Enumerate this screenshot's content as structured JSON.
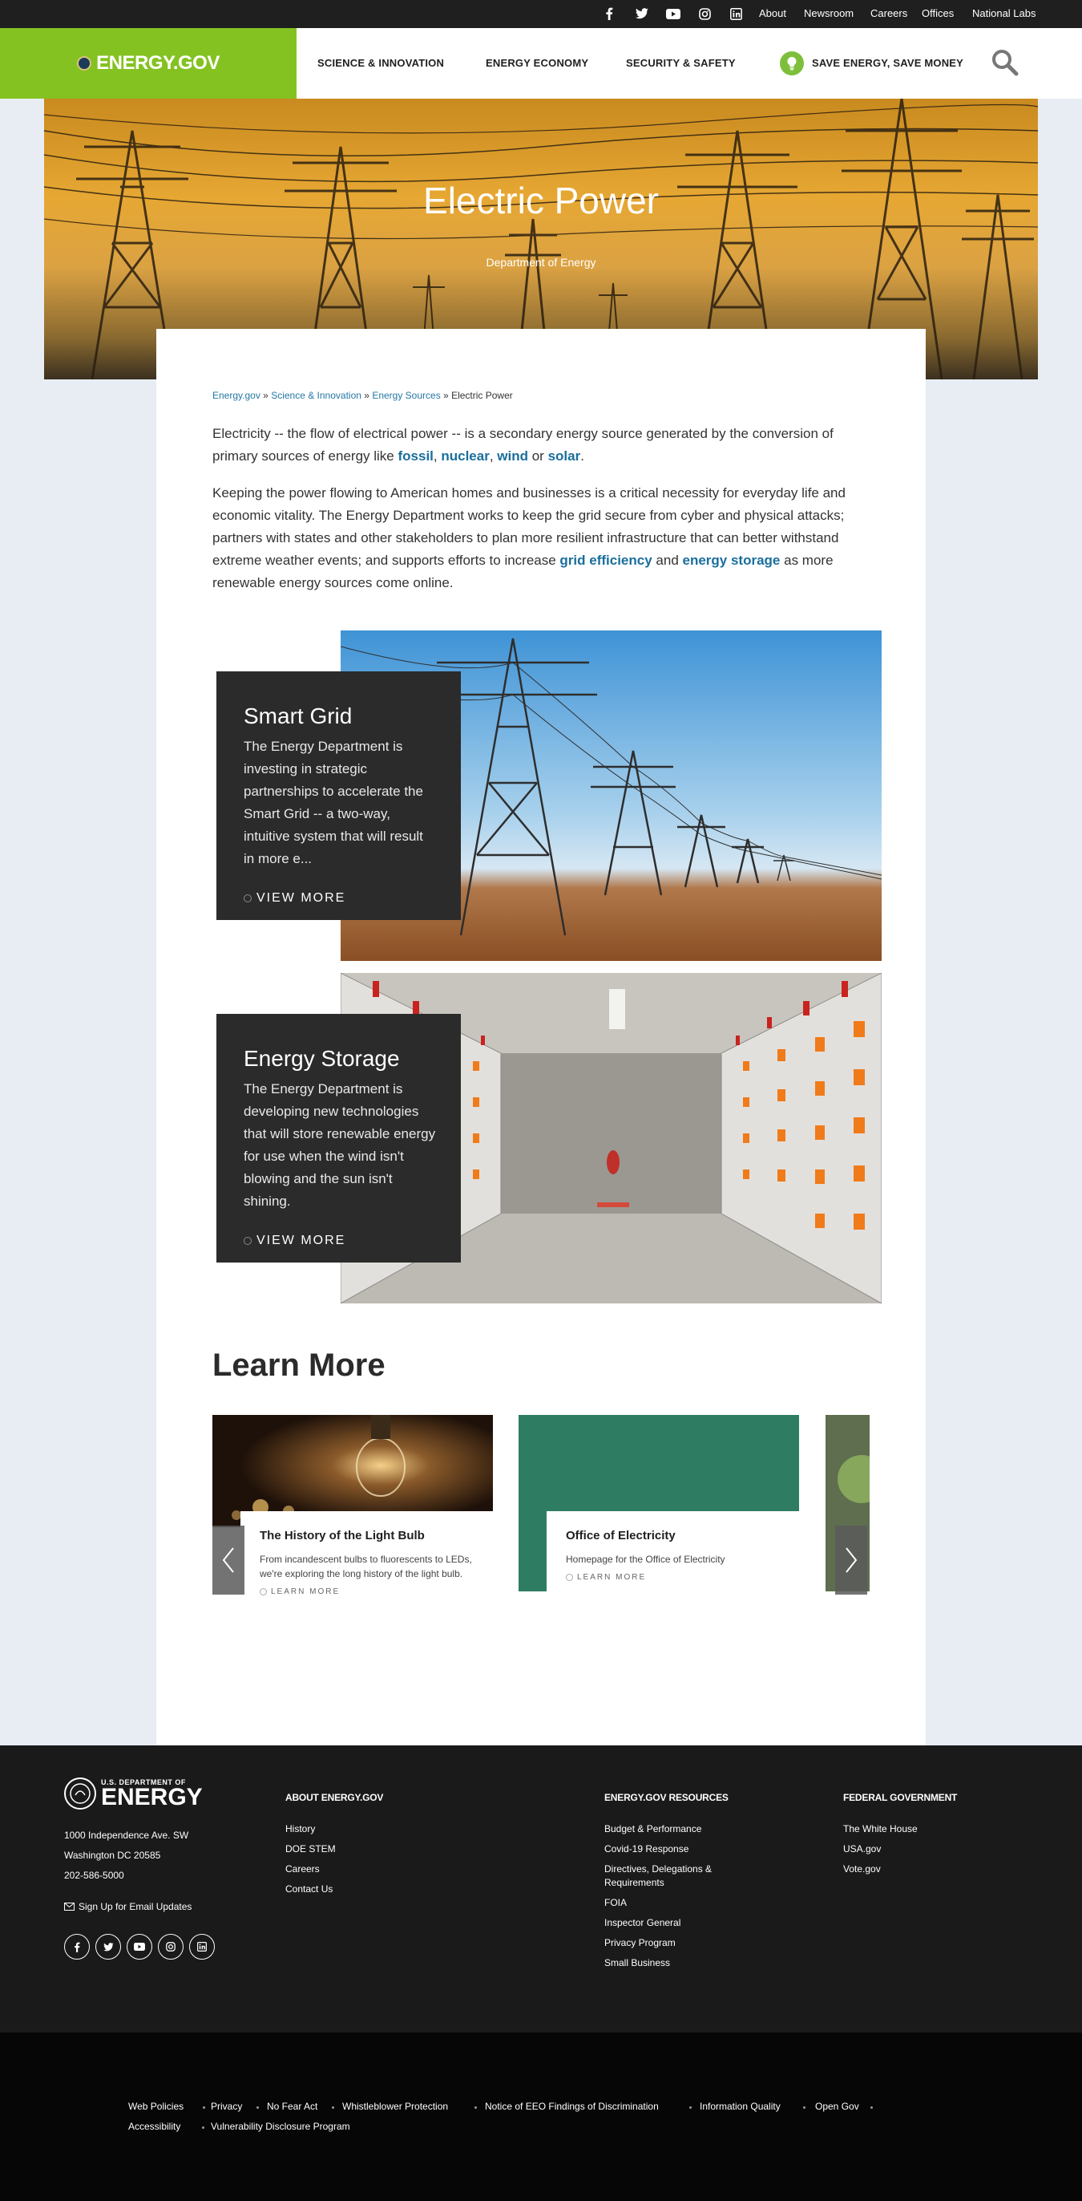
{
  "utility": {
    "links": [
      "About",
      "Newsroom",
      "Careers",
      "Offices",
      "National Labs"
    ],
    "social_icons": [
      "facebook-icon",
      "twitter-icon",
      "youtube-icon",
      "instagram-icon",
      "linkedin-icon"
    ]
  },
  "header": {
    "logo": "ENERGY.GOV",
    "nav": [
      "SCIENCE & INNOVATION",
      "ENERGY ECONOMY",
      "SECURITY & SAFETY",
      "SAVE ENERGY, SAVE MONEY"
    ],
    "brand_color": "#84c221"
  },
  "hero": {
    "title": "Electric Power",
    "subtitle": "Department of Energy"
  },
  "breadcrumb": {
    "items": [
      "Energy.gov",
      "Science & Innovation",
      "Energy Sources"
    ],
    "separator": "»",
    "current": "Electric Power"
  },
  "intro": {
    "p1_pre": "Electricity -- the flow of electrical power -- is a secondary energy source generated by the conversion of primary sources of energy like ",
    "p1_links": [
      "fossil",
      "nuclear",
      "wind",
      "solar"
    ],
    "p1_sep1": ", ",
    "p1_sep2": ", ",
    "p1_sep3": " or ",
    "p1_end": ".",
    "p2_pre": "Keeping the power flowing to American homes and businesses is a critical necessity for everyday life and economic vitality. The Energy Department works to keep the grid secure from cyber and physical attacks; partners with states and other stakeholders to plan more resilient infrastructure that can better withstand extreme weather events; and supports efforts to increase ",
    "p2_link1": "grid efficiency",
    "p2_mid": " and ",
    "p2_link2": "energy storage",
    "p2_end": " as more renewable energy sources come online."
  },
  "features": [
    {
      "title": "Smart Grid",
      "text": "The Energy Department is investing in strategic partnerships to accelerate the Smart Grid -- a two-way, intuitive system that will result in more e...",
      "link": "VIEW MORE"
    },
    {
      "title": "Energy Storage",
      "text": "The Energy Department is developing new technologies that will store renewable energy for use when the wind isn't blowing and the sun isn't shining.",
      "link": "VIEW MORE"
    }
  ],
  "learn_more": {
    "title": "Learn More",
    "cards": [
      {
        "title": "The History of the Light Bulb",
        "desc": "From incandescent bulbs to fluorescents to LEDs, we're exploring the long history of the light bulb.",
        "link": "LEARN MORE"
      },
      {
        "title": "Office of Electricity",
        "desc": "Homepage for the Office of Electricity",
        "link": "LEARN MORE"
      }
    ]
  },
  "footer": {
    "logo_small": "U.S. DEPARTMENT OF",
    "logo_big": "ENERGY",
    "address1": "1000 Independence Ave. SW",
    "address2": "Washington DC 20585",
    "phone": "202-586-5000",
    "signup": "Sign Up for Email Updates",
    "col1_head": "ABOUT ENERGY.GOV",
    "col1": [
      "History",
      "DOE STEM",
      "Careers",
      "Contact Us"
    ],
    "col2_head": "ENERGY.GOV RESOURCES",
    "col2": [
      "Budget & Performance",
      "Covid-19 Response",
      "Directives, Delegations & Requirements",
      "FOIA",
      "Inspector General",
      "Privacy Program",
      "Small Business"
    ],
    "col3_head": "FEDERAL GOVERNMENT",
    "col3": [
      "The White House",
      "USA.gov",
      "Vote.gov"
    ],
    "social_icons": [
      "facebook-icon",
      "twitter-icon",
      "youtube-icon",
      "instagram-icon",
      "linkedin-icon"
    ]
  },
  "subfooter": {
    "links": [
      "Web Policies",
      "Privacy",
      "No Fear Act",
      "Whistleblower Protection",
      "Notice of EEO Findings of Discrimination",
      "Information Quality",
      "Open Gov",
      "Accessibility",
      "Vulnerability Disclosure Program"
    ]
  }
}
